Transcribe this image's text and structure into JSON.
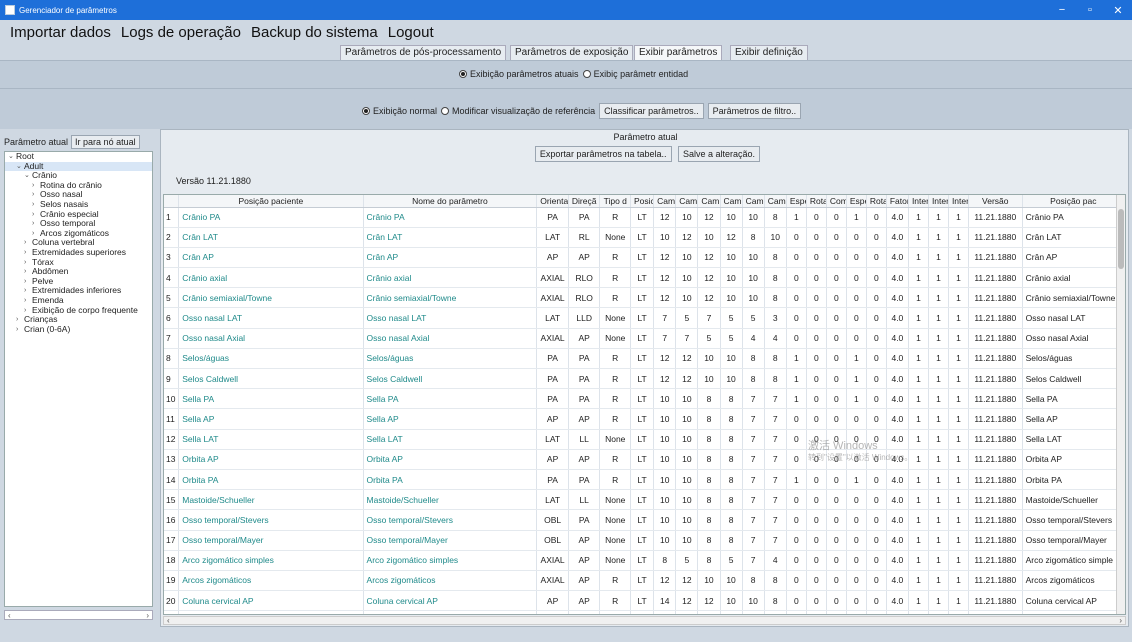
{
  "window": {
    "title": "Gerenciador de parâmetros",
    "minimize": "−",
    "maximize": "▫",
    "close": "✕"
  },
  "menu": [
    "Importar dados",
    "Logs de operação",
    "Backup do sistema",
    "Logout"
  ],
  "tabs": [
    "Parâmetros de pós-processamento",
    "Parâmetros de exposição",
    "Exibir parâmetros",
    "Exibir definição"
  ],
  "mode": {
    "option1": "Exibição parâmetros atuais",
    "option2": "Exibiç parâmetr entidad"
  },
  "view": {
    "option1": "Exibição normal",
    "option2": "Modificar visualização de referência",
    "classify_button": "Classificar parâmetros..",
    "filter_button": "Parâmetros de filtro.."
  },
  "left": {
    "label": "Parâmetro atual",
    "goto_button": "Ir para nó atual",
    "tree": [
      {
        "label": "Root",
        "chevron": "⌄"
      },
      {
        "label": "Adult",
        "chevron": "⌄"
      },
      {
        "label": "Crânio",
        "chevron": "⌄"
      },
      {
        "label": "Rotina do crânio",
        "chevron": "›"
      },
      {
        "label": "Osso nasal",
        "chevron": "›"
      },
      {
        "label": "Selos nasais",
        "chevron": "›"
      },
      {
        "label": "Crânio especial",
        "chevron": "›"
      },
      {
        "label": "Osso temporal",
        "chevron": "›"
      },
      {
        "label": "Arcos zigomáticos",
        "chevron": "›"
      },
      {
        "label": "Coluna vertebral",
        "chevron": "›"
      },
      {
        "label": "Extremidades superiores",
        "chevron": "›"
      },
      {
        "label": "Tórax",
        "chevron": "›"
      },
      {
        "label": "Abdômen",
        "chevron": "›"
      },
      {
        "label": "Pelve",
        "chevron": "›"
      },
      {
        "label": "Extremidades inferiores",
        "chevron": "›"
      },
      {
        "label": "Emenda",
        "chevron": "›"
      },
      {
        "label": "Exibição de corpo frequente",
        "chevron": "›"
      },
      {
        "label": "Crianças",
        "chevron": "›"
      },
      {
        "label": "Crian (0-6A)",
        "chevron": "›"
      }
    ]
  },
  "main": {
    "title": "Parâmetro atual",
    "export_button": "Exportar parâmetros na tabela..",
    "save_button": "Salve a alteração.",
    "version_label": "Versão  11.21.1880"
  },
  "table": {
    "headers": [
      "",
      "Posição paciente",
      "Nome do parâmetro",
      "Orienta",
      "Direçã",
      "Tipo d",
      "Posic",
      "Cam",
      "Cam",
      "Cam",
      "Cam",
      "Cam",
      "Cam",
      "Espe",
      "Rota",
      "Com",
      "Espe",
      "Rota",
      "Fator",
      "Inter",
      "Inter",
      "Inter",
      "Versão",
      "Posição pac"
    ],
    "rows": [
      [
        "1",
        "Crânio PA",
        "Crânio PA",
        "PA",
        "PA",
        "R",
        "LT",
        "12",
        "10",
        "12",
        "10",
        "10",
        "8",
        "1",
        "0",
        "0",
        "1",
        "0",
        "4.0",
        "1",
        "1",
        "1",
        "11.21.1880",
        "Crânio PA"
      ],
      [
        "2",
        "Crân LAT",
        "Crân LAT",
        "LAT",
        "RL",
        "None",
        "LT",
        "10",
        "12",
        "10",
        "12",
        "8",
        "10",
        "0",
        "0",
        "0",
        "0",
        "0",
        "4.0",
        "1",
        "1",
        "1",
        "11.21.1880",
        "Crân LAT"
      ],
      [
        "3",
        "Crân AP",
        "Crân AP",
        "AP",
        "AP",
        "R",
        "LT",
        "12",
        "10",
        "12",
        "10",
        "10",
        "8",
        "0",
        "0",
        "0",
        "0",
        "0",
        "4.0",
        "1",
        "1",
        "1",
        "11.21.1880",
        "Crân AP"
      ],
      [
        "4",
        "Crânio axial",
        "Crânio axial",
        "AXIAL",
        "RLO",
        "R",
        "LT",
        "12",
        "10",
        "12",
        "10",
        "10",
        "8",
        "0",
        "0",
        "0",
        "0",
        "0",
        "4.0",
        "1",
        "1",
        "1",
        "11.21.1880",
        "Crânio axial"
      ],
      [
        "5",
        "Crânio semiaxial/Towne",
        "Crânio semiaxial/Towne",
        "AXIAL",
        "RLO",
        "R",
        "LT",
        "12",
        "10",
        "12",
        "10",
        "10",
        "8",
        "0",
        "0",
        "0",
        "0",
        "0",
        "4.0",
        "1",
        "1",
        "1",
        "11.21.1880",
        "Crânio semiaxial/Towne"
      ],
      [
        "6",
        "Osso nasal LAT",
        "Osso nasal LAT",
        "LAT",
        "LLD",
        "None",
        "LT",
        "7",
        "5",
        "7",
        "5",
        "5",
        "3",
        "0",
        "0",
        "0",
        "0",
        "0",
        "4.0",
        "1",
        "1",
        "1",
        "11.21.1880",
        "Osso nasal LAT"
      ],
      [
        "7",
        "Osso nasal Axial",
        "Osso nasal Axial",
        "AXIAL",
        "AP",
        "None",
        "LT",
        "7",
        "7",
        "5",
        "5",
        "4",
        "4",
        "0",
        "0",
        "0",
        "0",
        "0",
        "4.0",
        "1",
        "1",
        "1",
        "11.21.1880",
        "Osso nasal Axial"
      ],
      [
        "8",
        "Selos/águas",
        "Selos/águas",
        "PA",
        "PA",
        "R",
        "LT",
        "12",
        "12",
        "10",
        "10",
        "8",
        "8",
        "1",
        "0",
        "0",
        "1",
        "0",
        "4.0",
        "1",
        "1",
        "1",
        "11.21.1880",
        "Selos/águas"
      ],
      [
        "9",
        "Selos Caldwell",
        "Selos Caldwell",
        "PA",
        "PA",
        "R",
        "LT",
        "12",
        "12",
        "10",
        "10",
        "8",
        "8",
        "1",
        "0",
        "0",
        "1",
        "0",
        "4.0",
        "1",
        "1",
        "1",
        "11.21.1880",
        "Selos Caldwell"
      ],
      [
        "10",
        "Sella PA",
        "Sella PA",
        "PA",
        "PA",
        "R",
        "LT",
        "10",
        "10",
        "8",
        "8",
        "7",
        "7",
        "1",
        "0",
        "0",
        "1",
        "0",
        "4.0",
        "1",
        "1",
        "1",
        "11.21.1880",
        "Sella PA"
      ],
      [
        "11",
        "Sella AP",
        "Sella AP",
        "AP",
        "AP",
        "R",
        "LT",
        "10",
        "10",
        "8",
        "8",
        "7",
        "7",
        "0",
        "0",
        "0",
        "0",
        "0",
        "4.0",
        "1",
        "1",
        "1",
        "11.21.1880",
        "Sella AP"
      ],
      [
        "12",
        "Sella LAT",
        "Sella LAT",
        "LAT",
        "LL",
        "None",
        "LT",
        "10",
        "10",
        "8",
        "8",
        "7",
        "7",
        "0",
        "0",
        "0",
        "0",
        "0",
        "4.0",
        "1",
        "1",
        "1",
        "11.21.1880",
        "Sella LAT"
      ],
      [
        "13",
        "Orbita AP",
        "Orbita AP",
        "AP",
        "AP",
        "R",
        "LT",
        "10",
        "10",
        "8",
        "8",
        "7",
        "7",
        "0",
        "0",
        "0",
        "0",
        "0",
        "4.0",
        "1",
        "1",
        "1",
        "11.21.1880",
        "Orbita AP"
      ],
      [
        "14",
        "Orbita PA",
        "Orbita PA",
        "PA",
        "PA",
        "R",
        "LT",
        "10",
        "10",
        "8",
        "8",
        "7",
        "7",
        "1",
        "0",
        "0",
        "1",
        "0",
        "4.0",
        "1",
        "1",
        "1",
        "11.21.1880",
        "Orbita PA"
      ],
      [
        "15",
        "Mastoide/Schueller",
        "Mastoide/Schueller",
        "LAT",
        "LL",
        "None",
        "LT",
        "10",
        "10",
        "8",
        "8",
        "7",
        "7",
        "0",
        "0",
        "0",
        "0",
        "0",
        "4.0",
        "1",
        "1",
        "1",
        "11.21.1880",
        "Mastoide/Schueller"
      ],
      [
        "16",
        "Osso temporal/Stevers",
        "Osso temporal/Stevers",
        "OBL",
        "PA",
        "None",
        "LT",
        "10",
        "10",
        "8",
        "8",
        "7",
        "7",
        "0",
        "0",
        "0",
        "0",
        "0",
        "4.0",
        "1",
        "1",
        "1",
        "11.21.1880",
        "Osso temporal/Stevers"
      ],
      [
        "17",
        "Osso temporal/Mayer",
        "Osso temporal/Mayer",
        "OBL",
        "AP",
        "None",
        "LT",
        "10",
        "10",
        "8",
        "8",
        "7",
        "7",
        "0",
        "0",
        "0",
        "0",
        "0",
        "4.0",
        "1",
        "1",
        "1",
        "11.21.1880",
        "Osso temporal/Mayer"
      ],
      [
        "18",
        "Arco zigomático simples",
        "Arco zigomático simples",
        "AXIAL",
        "AP",
        "None",
        "LT",
        "8",
        "5",
        "8",
        "5",
        "7",
        "4",
        "0",
        "0",
        "0",
        "0",
        "0",
        "4.0",
        "1",
        "1",
        "1",
        "11.21.1880",
        "Arco zigomático simple"
      ],
      [
        "19",
        "Arcos zigomáticos",
        "Arcos zigomáticos",
        "AXIAL",
        "AP",
        "R",
        "LT",
        "12",
        "12",
        "10",
        "10",
        "8",
        "8",
        "0",
        "0",
        "0",
        "0",
        "0",
        "4.0",
        "1",
        "1",
        "1",
        "11.21.1880",
        "Arcos zigomáticos"
      ],
      [
        "20",
        "Coluna cervical AP",
        "Coluna cervical AP",
        "AP",
        "AP",
        "R",
        "LT",
        "14",
        "12",
        "12",
        "10",
        "10",
        "8",
        "0",
        "0",
        "0",
        "0",
        "0",
        "4.0",
        "1",
        "1",
        "1",
        "11.21.1880",
        "Coluna cervical AP"
      ],
      [
        "21",
        "Cervical LAT",
        "Cervical LAT",
        "LAT",
        "LLD",
        "None",
        "LT",
        "14",
        "12",
        "12",
        "10",
        "10",
        "8",
        "0",
        "0",
        "0",
        "0",
        "0",
        "4.0",
        "1",
        "1",
        "1",
        "11.21.1880",
        "Cervical LAT"
      ],
      [
        "22",
        "Coluna cervical obliqua",
        "Coluna cervical obliqua",
        "OBL",
        "RLO",
        "None",
        "LT",
        "14",
        "12",
        "12",
        "10",
        "10",
        "8",
        "0",
        "0",
        "0",
        "0",
        "0",
        "4.0",
        "1",
        "1",
        "1",
        "11.21.1880",
        "Coluna cervical obliqu"
      ]
    ]
  },
  "watermark": {
    "line1": "激活 Windows",
    "line2": "转到\"设置\"以激活 Windows。"
  }
}
